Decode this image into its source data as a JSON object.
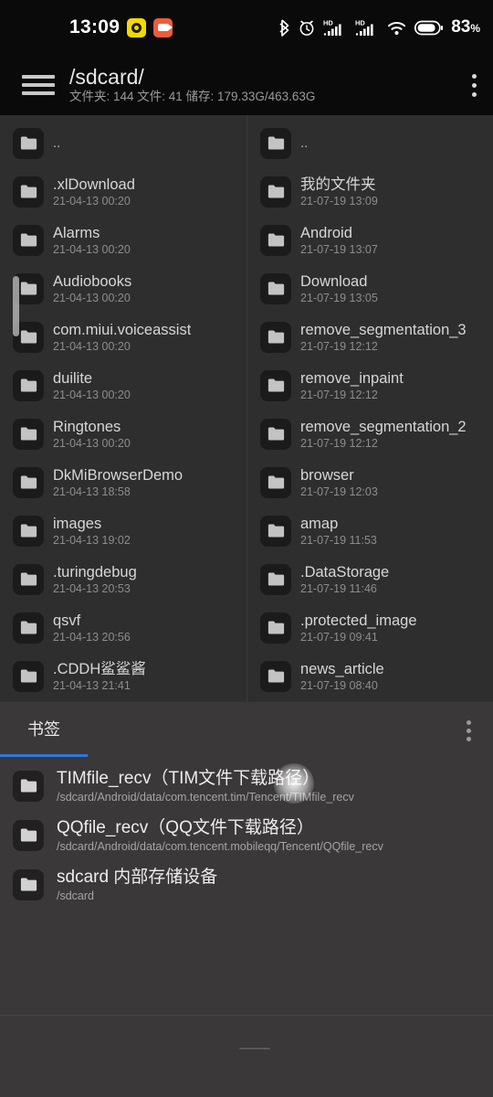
{
  "statusbar": {
    "clock": "13:09",
    "notification_icons": [
      "yellow-badge-icon",
      "video-recorder-icon"
    ],
    "right_icons": [
      "bluetooth-icon",
      "alarm-clock-icon",
      "signal-hd-1-icon",
      "signal-hd-2-icon",
      "wifi-icon",
      "battery-icon"
    ],
    "hd_label": "HD",
    "battery_percent": "83",
    "percent_symbol": "%"
  },
  "appbar": {
    "menu_icon": "hamburger-icon",
    "title": "/sdcard/",
    "subtitle": "文件夹: 144  文件: 41  储存: 179.33G/463.63G",
    "overflow_icon": "more-vertical-icon"
  },
  "left_column": [
    {
      "name": "..",
      "date": ""
    },
    {
      "name": ".xlDownload",
      "date": "21-04-13 00:20"
    },
    {
      "name": "Alarms",
      "date": "21-04-13 00:20"
    },
    {
      "name": "Audiobooks",
      "date": "21-04-13 00:20"
    },
    {
      "name": "com.miui.voiceassist",
      "date": "21-04-13 00:20"
    },
    {
      "name": "duilite",
      "date": "21-04-13 00:20"
    },
    {
      "name": "Ringtones",
      "date": "21-04-13 00:20"
    },
    {
      "name": "DkMiBrowserDemo",
      "date": "21-04-13 18:58"
    },
    {
      "name": "images",
      "date": "21-04-13 19:02"
    },
    {
      "name": ".turingdebug",
      "date": "21-04-13 20:53"
    },
    {
      "name": "qsvf",
      "date": "21-04-13 20:56"
    },
    {
      "name": ".CDDH鲨鲨酱",
      "date": "21-04-13 21:41"
    }
  ],
  "right_column": [
    {
      "name": "..",
      "date": ""
    },
    {
      "name": "我的文件夹",
      "date": "21-07-19 13:09"
    },
    {
      "name": "Android",
      "date": "21-07-19 13:07"
    },
    {
      "name": "Download",
      "date": "21-07-19 13:05"
    },
    {
      "name": "remove_segmentation_3",
      "date": "21-07-19 12:12"
    },
    {
      "name": "remove_inpaint",
      "date": "21-07-19 12:12"
    },
    {
      "name": "remove_segmentation_2",
      "date": "21-07-19 12:12"
    },
    {
      "name": "browser",
      "date": "21-07-19 12:03"
    },
    {
      "name": "amap",
      "date": "21-07-19 11:53"
    },
    {
      "name": ".DataStorage",
      "date": "21-07-19 11:46"
    },
    {
      "name": ".protected_image",
      "date": "21-07-19 09:41"
    },
    {
      "name": "news_article",
      "date": "21-07-19 08:40"
    }
  ],
  "bookmarks_sheet": {
    "title": "书签",
    "overflow_icon": "more-vertical-icon",
    "tab_indicator_color": "#2b79dd",
    "items": [
      {
        "name": "TIMfile_recv（TIM文件下载路径）",
        "path": "/sdcard/Android/data/com.tencent.tim/Tencent/TIMfile_recv"
      },
      {
        "name": "QQfile_recv（QQ文件下载路径）",
        "path": "/sdcard/Android/data/com.tencent.mobileqq/Tencent/QQfile_recv"
      },
      {
        "name": "sdcard 内部存储设备",
        "path": "/sdcard"
      }
    ]
  },
  "colors": {
    "status_bar_bg": "#0a0a0a",
    "list_bg": "#2e2e2e",
    "sheet_bg": "#3b3839",
    "accent": "#2b79dd",
    "folder_glyph": "#c3c3c3",
    "primary_text": "#d7d7d7",
    "secondary_text": "#8d8d8d"
  }
}
